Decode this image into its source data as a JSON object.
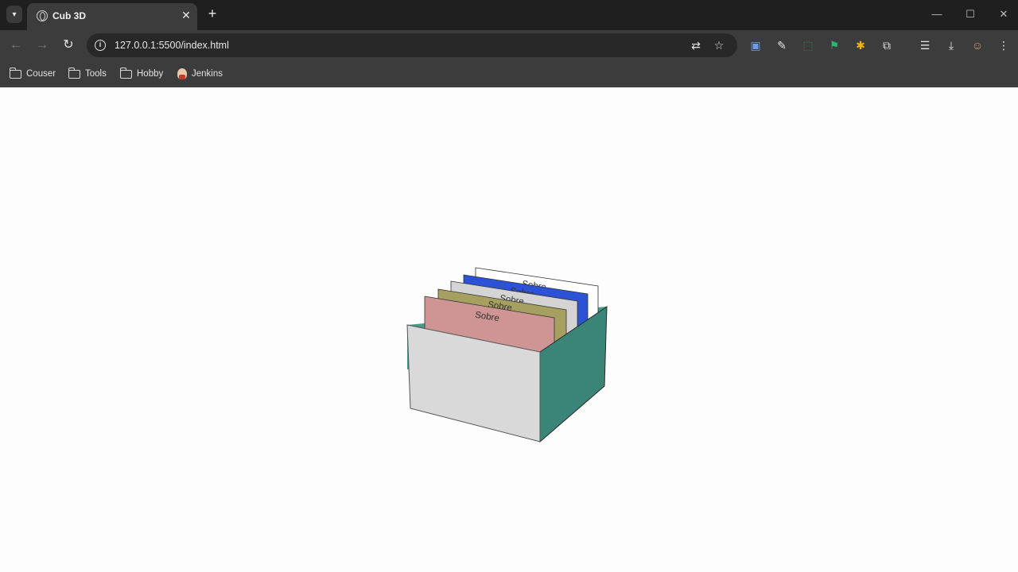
{
  "browser": {
    "tab": {
      "title": "Cub 3D",
      "close_symbol": "✕"
    },
    "new_tab_symbol": "+",
    "window_controls": [
      "—",
      "☐",
      "✕"
    ],
    "url": "127.0.0.1:5500/index.html",
    "bookmarks": [
      {
        "label": "Couser",
        "icon": "folder-icon"
      },
      {
        "label": "Tools",
        "icon": "folder-icon"
      },
      {
        "label": "Hobby",
        "icon": "folder-icon"
      },
      {
        "label": "Jenkins",
        "icon": "jenkins-icon"
      }
    ]
  },
  "scene": {
    "box": {
      "front_color": "#d9d9d9",
      "side_color": "#3a8478",
      "inner_color": "#4a9a8a"
    },
    "cards": [
      {
        "label": "Sobre",
        "color": "#ffffff"
      },
      {
        "label": "Sobre",
        "color": "#2c52d6"
      },
      {
        "label": "Sobre",
        "color": "#d4d4d4"
      },
      {
        "label": "Sobre",
        "color": "#a6a060"
      },
      {
        "label": "Sobre",
        "color": "#cf9494"
      }
    ]
  }
}
